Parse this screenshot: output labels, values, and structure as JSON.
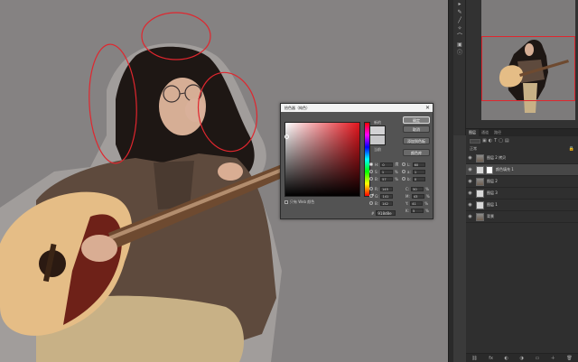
{
  "tools": {
    "icons": [
      "arrow-icon",
      "eyedropper-icon",
      "brush-icon",
      "wand-icon",
      "lasso-icon",
      "stamp-icon",
      "info-icon"
    ],
    "glyphs": [
      "▸",
      "✎",
      "╱",
      "✧",
      "⌒",
      "▣",
      "ⓘ"
    ]
  },
  "color_picker": {
    "title": "拾色器（纯色）",
    "close": "✕",
    "buttons": [
      "确定",
      "取消",
      "添加到色板",
      "颜色库"
    ],
    "new_label": "新的",
    "current_label": "当前",
    "only_web_colors": "只有 Web 颜色",
    "hsb": [
      {
        "label": "H:",
        "value": "0",
        "unit": "度"
      },
      {
        "label": "S:",
        "value": "1",
        "unit": "%"
      },
      {
        "label": "B:",
        "value": "57",
        "unit": "%"
      }
    ],
    "rgb": [
      {
        "label": "R:",
        "value": "145"
      },
      {
        "label": "G:",
        "value": "141"
      },
      {
        "label": "B:",
        "value": "142"
      }
    ],
    "lab": [
      {
        "label": "L:",
        "value": "60"
      },
      {
        "label": "a:",
        "value": "1"
      },
      {
        "label": "b:",
        "value": "0"
      }
    ],
    "cmyk": [
      {
        "label": "C:",
        "value": "50",
        "unit": "%"
      },
      {
        "label": "M:",
        "value": "43",
        "unit": "%"
      },
      {
        "label": "Y:",
        "value": "41",
        "unit": "%"
      },
      {
        "label": "K:",
        "value": "5",
        "unit": "%"
      }
    ],
    "hex_label": "#",
    "hex": "918d8e",
    "colors": {
      "hue": "#e3151d",
      "new": "#d3d3d5",
      "current": "#c8c8ca"
    }
  },
  "layers": {
    "tabs": [
      "图层",
      "通道",
      "路径"
    ],
    "kind_label": "正常",
    "rows": [
      {
        "name": "图层 2 拷贝",
        "thumb": "photo",
        "mask": false,
        "selected": false
      },
      {
        "name": "颜色填充 1",
        "thumb": "fill",
        "mask": true,
        "selected": true
      },
      {
        "name": "图层 2",
        "thumb": "photo",
        "mask": false,
        "selected": false
      },
      {
        "name": "图层 3",
        "thumb": "fill",
        "mask": false,
        "selected": false
      },
      {
        "name": "图层 1",
        "thumb": "fill",
        "mask": false,
        "selected": false
      },
      {
        "name": "背景",
        "thumb": "photo",
        "mask": false,
        "selected": false
      }
    ],
    "bottom_icons": [
      "link-icon",
      "fx-icon",
      "mask-icon",
      "adjustment-icon",
      "folder-icon",
      "new-layer-icon",
      "trash-icon"
    ],
    "bottom_glyphs": [
      "⛓",
      "fx",
      "◐",
      "◑",
      "▭",
      "＋",
      "🗑"
    ]
  }
}
